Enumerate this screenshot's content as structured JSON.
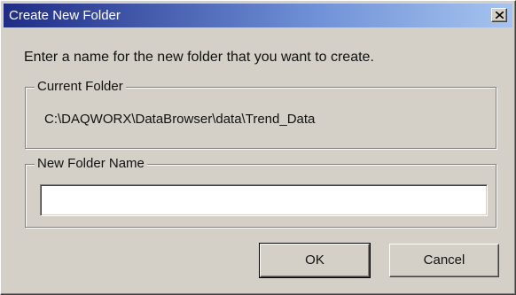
{
  "window": {
    "title": "Create New Folder",
    "close_icon": "close-x-icon"
  },
  "prompt": "Enter a name for the new folder that you want to create.",
  "current_folder": {
    "label": "Current Folder",
    "path": "C:\\DAQWORX\\DataBrowser\\data\\Trend_Data"
  },
  "new_folder": {
    "label": "New Folder Name",
    "value": ""
  },
  "buttons": {
    "ok_label": "OK",
    "cancel_label": "Cancel"
  },
  "colors": {
    "face": "#d4d0c8",
    "title_start": "#1f2c85",
    "title_end": "#a6c4ef"
  }
}
